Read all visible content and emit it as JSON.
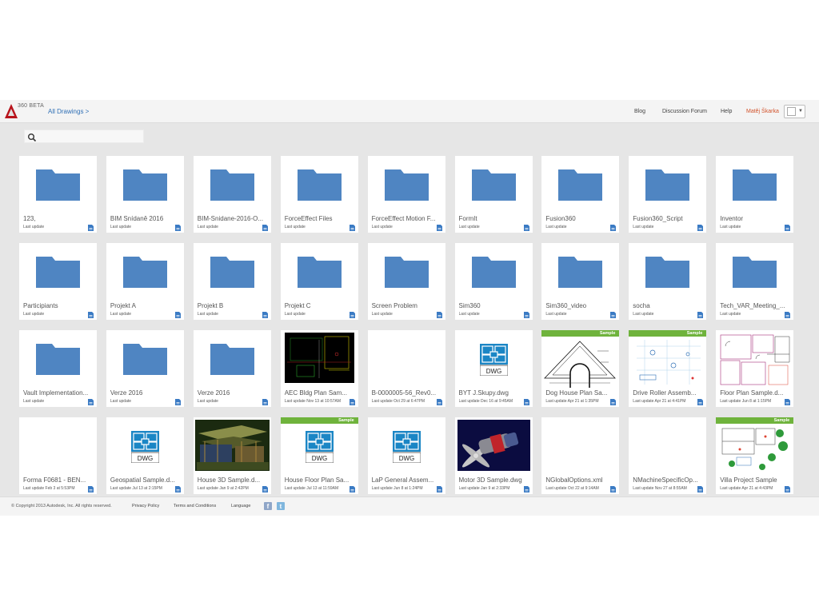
{
  "header": {
    "logo_version": "360 BETA",
    "breadcrumb": "All Drawings >",
    "nav": {
      "blog": "Blog",
      "forum": "Discussion Forum",
      "help": "Help"
    },
    "user_name": "Matěj Škarka"
  },
  "search": {
    "placeholder": "",
    "value": ""
  },
  "colors": {
    "folder": "#4f85c2",
    "sample_badge": "#6fb33c",
    "user_name": "#d2532c",
    "link": "#2f6fb5"
  },
  "items": [
    {
      "name": "123,",
      "date": "Last update",
      "kind": "folder"
    },
    {
      "name": "BIM Snídaně 2016",
      "date": "Last update",
      "kind": "folder"
    },
    {
      "name": "BIM-Snidane-2016-O...",
      "date": "Last update",
      "kind": "folder"
    },
    {
      "name": "ForceEffect Files",
      "date": "Last update",
      "kind": "folder"
    },
    {
      "name": "ForceEffect Motion F...",
      "date": "Last update",
      "kind": "folder"
    },
    {
      "name": "FormIt",
      "date": "Last update",
      "kind": "folder"
    },
    {
      "name": "Fusion360",
      "date": "Last update",
      "kind": "folder"
    },
    {
      "name": "Fusion360_Script",
      "date": "Last update",
      "kind": "folder"
    },
    {
      "name": "Inventor",
      "date": "Last update",
      "kind": "folder"
    },
    {
      "name": "Participiants",
      "date": "Last update",
      "kind": "folder"
    },
    {
      "name": "Projekt A",
      "date": "Last update",
      "kind": "folder"
    },
    {
      "name": "Projekt B",
      "date": "Last update",
      "kind": "folder"
    },
    {
      "name": "Projekt C",
      "date": "Last update",
      "kind": "folder"
    },
    {
      "name": "Screen Problem",
      "date": "Last update",
      "kind": "folder"
    },
    {
      "name": "Sim360",
      "date": "Last update",
      "kind": "folder"
    },
    {
      "name": "Sim360_video",
      "date": "Last update",
      "kind": "folder"
    },
    {
      "name": "socha",
      "date": "Last update",
      "kind": "folder"
    },
    {
      "name": "Tech_VAR_Meeting_...",
      "date": "Last update",
      "kind": "folder"
    },
    {
      "name": "Vault Implementation...",
      "date": "Last update",
      "kind": "folder"
    },
    {
      "name": "Verze 2016",
      "date": "Last update",
      "kind": "folder"
    },
    {
      "name": "Verze 2016",
      "date": "Last update",
      "kind": "folder"
    },
    {
      "name": "AEC Bldg Plan Sam...",
      "date": "Last update Nov 13 at 10:57AM",
      "kind": "aec"
    },
    {
      "name": "B-0000005-56_Rev0...",
      "date": "Last update Oct 29 at 6:47PM",
      "kind": "blank"
    },
    {
      "name": "BYT J.Skupy.dwg",
      "date": "Last update Dec 16 at 9:45AM",
      "kind": "dwg",
      "dwg_label": "DWG"
    },
    {
      "name": "Dog House Plan Sa...",
      "date": "Last update Apr 21 at 1:35PM",
      "kind": "doghouse",
      "badge": "Sample"
    },
    {
      "name": "Drive Roller Assemb...",
      "date": "Last update Apr 21 at 4:41PM",
      "kind": "roller",
      "badge": "Sample"
    },
    {
      "name": "Floor Plan Sample.d...",
      "date": "Last update Jun 8 at 1:15PM",
      "kind": "floorplan"
    },
    {
      "name": "Forma F0681 - BEN...",
      "date": "Last update Feb 3 at 5:53PM",
      "kind": "blank"
    },
    {
      "name": "Geospatial Sample.d...",
      "date": "Last update Jul 13 at 2:15PM",
      "kind": "dwg",
      "dwg_label": "DWG"
    },
    {
      "name": "House 3D Sample.d...",
      "date": "Last update Jan 9 at 2:42PM",
      "kind": "house3d"
    },
    {
      "name": "House Floor Plan Sa...",
      "date": "Last update Jul 13 at 11:59AM",
      "kind": "dwg",
      "dwg_label": "DWG",
      "badge": "Sample"
    },
    {
      "name": "LaP General Assem...",
      "date": "Last update Jun 8 at 1:24PM",
      "kind": "dwg",
      "dwg_label": "DWG"
    },
    {
      "name": "Motor 3D Sample.dwg",
      "date": "Last update Jan 9 at 2:33PM",
      "kind": "motor"
    },
    {
      "name": "NGlobalOptions.xml",
      "date": "Last update Oct 22 at 9:14AM",
      "kind": "blank"
    },
    {
      "name": "NMachineSpecificOp...",
      "date": "Last update Nov 27 at 8:55AM",
      "kind": "blank"
    },
    {
      "name": "Villa Project Sample",
      "date": "Last update Apr 21 at 4:43PM",
      "kind": "villa",
      "badge": "Sample"
    }
  ],
  "footer": {
    "copyright": "© Copyright 2013 Autodesk, Inc. All rights reserved.",
    "privacy": "Privacy Policy",
    "terms": "Terms and Conditions",
    "language": "Language"
  }
}
